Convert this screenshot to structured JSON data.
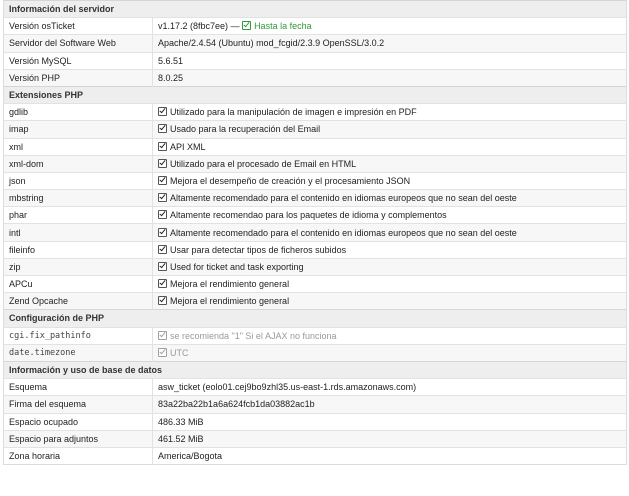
{
  "sections": {
    "server": {
      "title": "Información del servidor",
      "version_osticket": {
        "label": "Versión osTicket",
        "value": "v1.17.2 (8fbc7ee) —",
        "uptodate": "Hasta la fecha"
      },
      "web_software": {
        "label": "Servidor del Software Web",
        "value": "Apache/2.4.54 (Ubuntu) mod_fcgid/2.3.9 OpenSSL/3.0.2"
      },
      "mysql_version": {
        "label": "Versión MySQL",
        "value": "5.6.51"
      },
      "php_version": {
        "label": "Versión PHP",
        "value": "8.0.25"
      }
    },
    "php_ext": {
      "title": "Extensiones PHP",
      "items": [
        {
          "label": "gdlib",
          "value": "Utilizado para la manipulación de imagen e impresión en PDF"
        },
        {
          "label": "imap",
          "value": "Usado para la recuperación del Email"
        },
        {
          "label": "xml",
          "value": "API XML"
        },
        {
          "label": "xml-dom",
          "value": "Utilizado para el procesado de Email en HTML"
        },
        {
          "label": "json",
          "value": "Mejora el desempeño de creación y el procesamiento JSON"
        },
        {
          "label": "mbstring",
          "value": "Altamente recomendado para el contenido en idiomas europeos que no sean del oeste"
        },
        {
          "label": "phar",
          "value": "Altamente recomendao para los paquetes de idioma y complementos"
        },
        {
          "label": "intl",
          "value": "Altamente recomendado para el contenido en idiomas europeos que no sean del oeste"
        },
        {
          "label": "fileinfo",
          "value": "Usar para detectar tipos de ficheros subidos"
        },
        {
          "label": "zip",
          "value": "Used for ticket and task exporting"
        },
        {
          "label": "APCu",
          "value": "Mejora el rendimiento general"
        },
        {
          "label": "Zend Opcache",
          "value": "Mejora el rendimiento general"
        }
      ]
    },
    "php_config": {
      "title": "Configuración de PHP",
      "fix_pathinfo": {
        "label": "cgi.fix_pathinfo",
        "value": "se recomienda \"1\" Si el AJAX no funciona"
      },
      "timezone": {
        "label": "date.timezone",
        "value": "UTC"
      }
    },
    "database": {
      "title": "Información y uso de base de datos",
      "schema": {
        "label": "Esquema",
        "value": "asw_ticket (eolo01.cej9bo9zhl35.us-east-1.rds.amazonaws.com)"
      },
      "signature": {
        "label": "Firma del esquema",
        "value": "83a22ba22b1a6a624fcb1da03882ac1b"
      },
      "space_used": {
        "label": "Espacio ocupado",
        "value": "486.33 MiB"
      },
      "attachments_space": {
        "label": "Espacio para adjuntos",
        "value": "461.52 MiB"
      },
      "timezone": {
        "label": "Zona horaria",
        "value": "America/Bogota"
      }
    }
  },
  "colors": {
    "section_bg": "#eeeeee",
    "alt_row_bg": "#f7f7f7",
    "ok_green": "#2f9a3a",
    "border": "#e2e2e2"
  },
  "icons": {
    "check": "check-icon",
    "check_green": "check-icon-green",
    "check_grey": "check-icon-grey"
  }
}
